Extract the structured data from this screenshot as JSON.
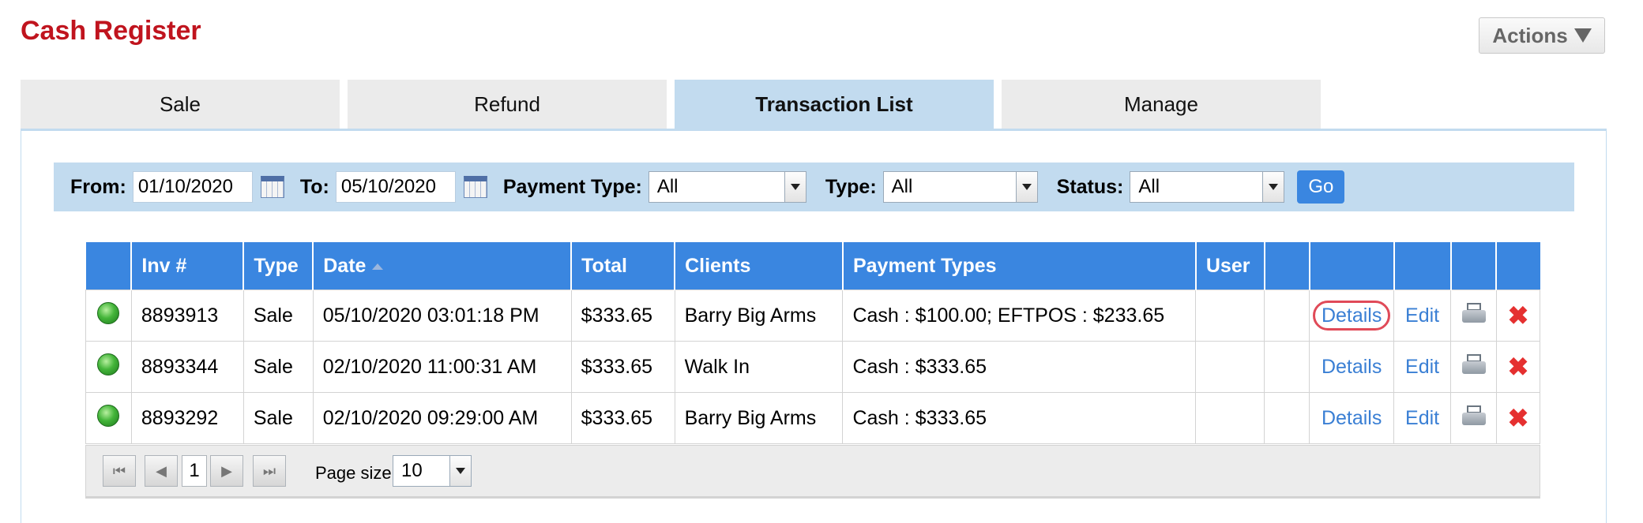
{
  "header": {
    "title": "Cash Register",
    "actions_label": "Actions"
  },
  "tabs": [
    {
      "label": "Sale"
    },
    {
      "label": "Refund"
    },
    {
      "label": "Transaction List",
      "active": true
    },
    {
      "label": "Manage"
    }
  ],
  "filters": {
    "from_label": "From:",
    "from_value": "01/10/2020",
    "to_label": "To:",
    "to_value": "05/10/2020",
    "payment_type_label": "Payment Type:",
    "payment_type_value": "All",
    "type_label": "Type:",
    "type_value": "All",
    "status_label": "Status:",
    "status_value": "All",
    "go_label": "Go"
  },
  "table": {
    "headers": [
      "",
      "Inv #",
      "Type",
      "Date",
      "Total",
      "Clients",
      "Payment Types",
      "User",
      "",
      "",
      "",
      "",
      ""
    ],
    "rows": [
      {
        "inv": "8893913",
        "type": "Sale",
        "date": "05/10/2020 03:01:18 PM",
        "total": "$333.65",
        "client": "Barry Big Arms",
        "payment": "Cash : $100.00; EFTPOS : $233.65",
        "user": "",
        "details": "Details",
        "edit": "Edit"
      },
      {
        "inv": "8893344",
        "type": "Sale",
        "date": "02/10/2020 11:00:31 AM",
        "total": "$333.65",
        "client": "Walk In",
        "payment": "Cash : $333.65",
        "user": "",
        "details": "Details",
        "edit": "Edit"
      },
      {
        "inv": "8893292",
        "type": "Sale",
        "date": "02/10/2020 09:29:00 AM",
        "total": "$333.65",
        "client": "Barry Big Arms",
        "payment": "Cash : $333.65",
        "user": "",
        "details": "Details",
        "edit": "Edit"
      }
    ]
  },
  "pager": {
    "current_page": "1",
    "page_size_label": "Page size:",
    "page_size_value": "10"
  },
  "colors": {
    "title": "#c0141e",
    "header_blue": "#3a86e0",
    "tab_active": "#c2dbef",
    "link": "#3a7fd4",
    "delete": "#e53030",
    "highlight_ring": "#e04a58"
  },
  "icons": {
    "status": "green-status-dot-icon",
    "print": "printer-icon",
    "delete": "delete-x-icon",
    "calendar": "calendar-icon"
  }
}
